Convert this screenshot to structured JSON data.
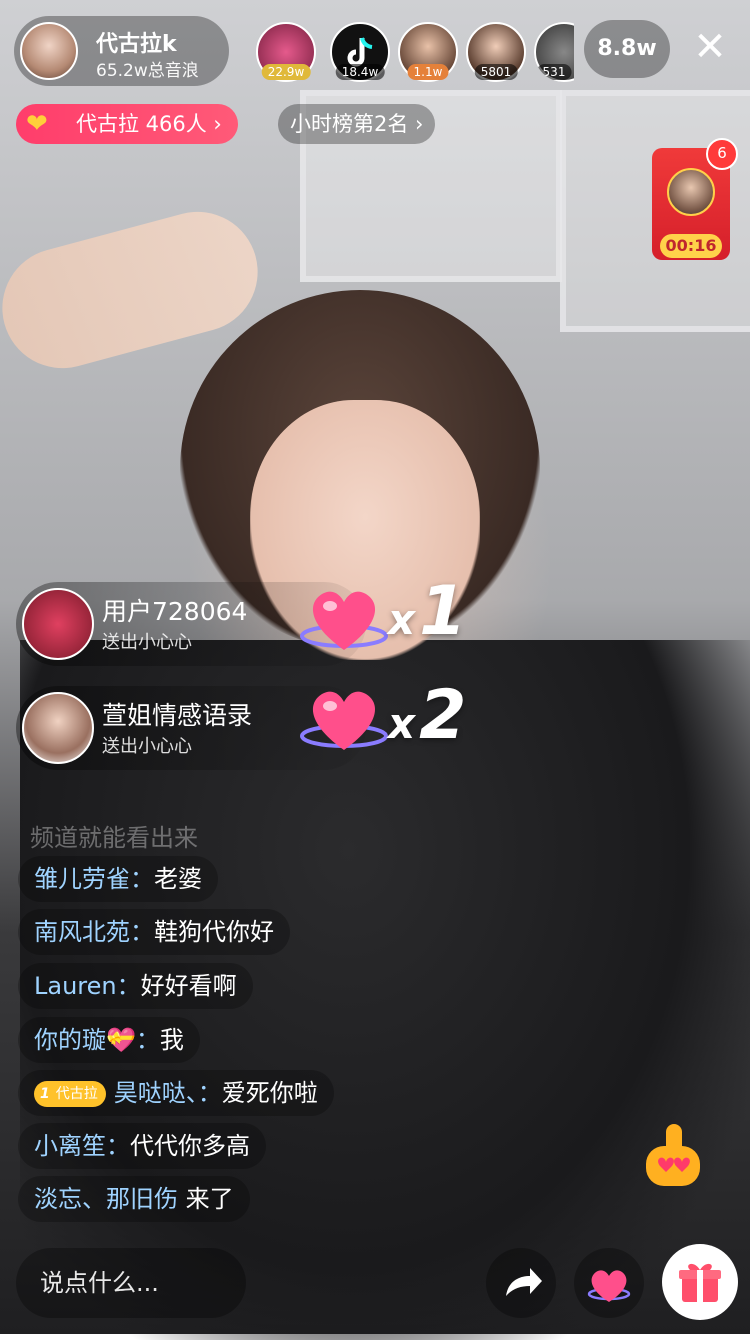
{
  "host": {
    "name": "代古拉k",
    "sub": "65.2w总音浪"
  },
  "viewers": [
    {
      "count": "22.9w",
      "color": "#c84b7a"
    },
    {
      "count": "18.4w",
      "color": "#1a1a1a"
    },
    {
      "count": "1.1w",
      "color": "#8a6a58"
    },
    {
      "count": "5801",
      "color": "#6b5040"
    },
    {
      "count": "531",
      "color": "#555555"
    }
  ],
  "viewer_total": "8.8w",
  "fan_club": "代古拉 466人 ›",
  "hour_rank": "小时榜第2名 ›",
  "red_packet": {
    "badge": "6",
    "timer": "00:16"
  },
  "gifts": [
    {
      "name": "用户728064",
      "action": "送出小心心",
      "x": "x",
      "count": "1"
    },
    {
      "name": "萱姐情感语录",
      "action": "送出小心心",
      "x": "x",
      "count": "2"
    }
  ],
  "faded_line": "频道就能看出来",
  "chat": [
    {
      "user": "雏儿劳雀：",
      "msg": "老婆"
    },
    {
      "user": "南风北苑：",
      "msg": "鞋狗代你好"
    },
    {
      "user": "Lauren：",
      "msg": "好好看啊"
    },
    {
      "user": "你的璇💝：",
      "msg": "我"
    },
    {
      "tag_level": "1",
      "tag_name": "代古拉",
      "user": "昊哒哒、：",
      "msg": "爱死你啦"
    },
    {
      "user": "小离笙：",
      "msg": "代代你多高"
    },
    {
      "user": "淡忘、那旧伤",
      "msg": " 来了"
    }
  ],
  "input_placeholder": "说点什么...",
  "icons": {
    "close": "close-icon",
    "share": "share-icon",
    "heart": "heart-icon",
    "gift": "gift-icon"
  },
  "colors": {
    "fans_pill": "#ff3d6b",
    "chat_username": "#9fd3ff",
    "red_packet": "#e02a32",
    "timer": "#ffd24a"
  }
}
